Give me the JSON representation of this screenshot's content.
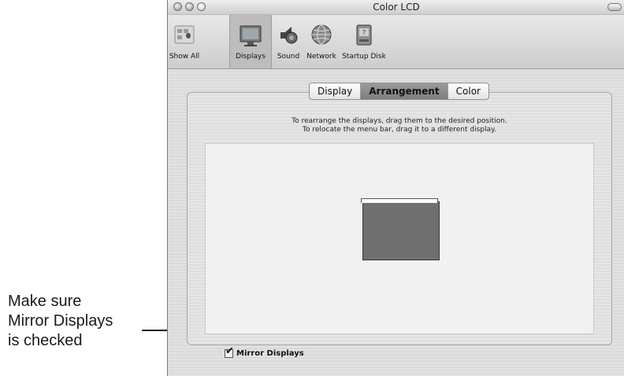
{
  "callout": {
    "lines": [
      "Make sure",
      "Mirror Displays",
      "is checked"
    ]
  },
  "window": {
    "title": "Color LCD"
  },
  "toolbar": {
    "items": [
      {
        "label": "Show All",
        "icon": "show-all-icon",
        "selected": false
      },
      {
        "label": "Displays",
        "icon": "displays-icon",
        "selected": true
      },
      {
        "label": "Sound",
        "icon": "sound-icon",
        "selected": false
      },
      {
        "label": "Network",
        "icon": "network-icon",
        "selected": false
      },
      {
        "label": "Startup Disk",
        "icon": "startup-disk-icon",
        "selected": false
      }
    ]
  },
  "tabs": [
    {
      "label": "Display",
      "active": false
    },
    {
      "label": "Arrangement",
      "active": true
    },
    {
      "label": "Color",
      "active": false
    }
  ],
  "instructions": {
    "line1": "To rearrange the displays, drag them to the desired position.",
    "line2": "To relocate the menu bar, drag it to a different display."
  },
  "mirror_displays": {
    "label": "Mirror Displays",
    "checked": true
  }
}
